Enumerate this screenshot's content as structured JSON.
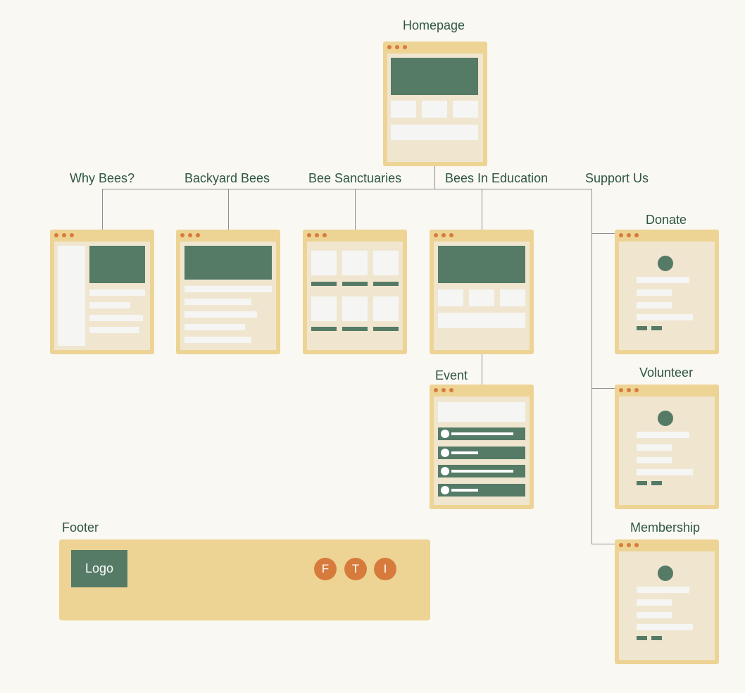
{
  "colors": {
    "background": "#faf8f3",
    "frame": "#edd494",
    "screen": "#f0e6d0",
    "accent_green": "#557b66",
    "accent_orange": "#d77b3c",
    "text": "#2e5641",
    "connector": "#8f8f8f"
  },
  "pages": {
    "homepage": "Homepage",
    "why_bees": "Why Bees?",
    "backyard_bees": "Backyard Bees",
    "bee_sanctuaries": "Bee Sanctuaries",
    "bees_in_education": "Bees In Education",
    "support_us": "Support Us",
    "donate": "Donate",
    "volunteer": "Volunteer",
    "membership": "Membership",
    "event": "Event"
  },
  "footer": {
    "label": "Footer",
    "logo": "Logo",
    "social": [
      "F",
      "T",
      "I"
    ]
  }
}
